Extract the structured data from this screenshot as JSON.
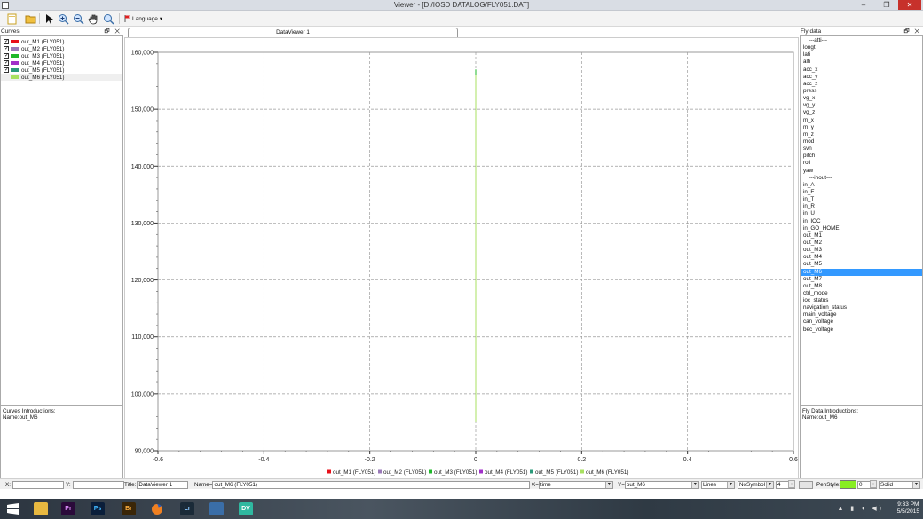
{
  "window": {
    "title": "Viewer - [D:/IOSD DATALOG/FLY051.DAT]"
  },
  "toolbar": {
    "language_label": "Language",
    "language_arrow": "▾"
  },
  "curves_panel": {
    "title": "Curves",
    "items": [
      {
        "label": "out_M1 (FLY051)",
        "color": "#e8101a",
        "checked": true
      },
      {
        "label": "out_M2 (FLY051)",
        "color": "#9a7ab8",
        "checked": true
      },
      {
        "label": "out_M3 (FLY051)",
        "color": "#1fb82a",
        "checked": true
      },
      {
        "label": "out_M4 (FLY051)",
        "color": "#a030c8",
        "checked": true
      },
      {
        "label": "out_M5 (FLY051)",
        "color": "#2a9a7a",
        "checked": true
      },
      {
        "label": "out_M6 (FLY051)",
        "color": "#a8e060",
        "checked": false
      }
    ],
    "intro_title": "Curves Introductions:",
    "intro_name": "Name:out_M6"
  },
  "tab": {
    "label": "DataViewer 1"
  },
  "chart_data": {
    "type": "line",
    "title": "",
    "xlabel": "",
    "ylabel": "",
    "xlim": [
      -0.6,
      0.6
    ],
    "ylim": [
      90000,
      160000
    ],
    "x_ticks": [
      "-0.6",
      "-0.4",
      "-0.2",
      "0",
      "0.2",
      "0.4",
      "0.6"
    ],
    "y_ticks": [
      "90,000",
      "100,000",
      "110,000",
      "120,000",
      "130,000",
      "140,000",
      "150,000",
      "160,000"
    ],
    "grid": true,
    "legend_placement": "bottom",
    "series": [
      {
        "name": "out_M1 (FLY051)",
        "color": "#e8101a",
        "x": [
          0,
          0
        ],
        "y": [
          150000,
          150000
        ]
      },
      {
        "name": "out_M2 (FLY051)",
        "color": "#9a7ab8",
        "x": [
          0,
          0
        ],
        "y": [
          150000,
          150000
        ]
      },
      {
        "name": "out_M3 (FLY051)",
        "color": "#1fb82a",
        "x": [
          0,
          0
        ],
        "y": [
          150000,
          157000
        ]
      },
      {
        "name": "out_M4 (FLY051)",
        "color": "#a030c8",
        "x": [
          0,
          0
        ],
        "y": [
          150000,
          150000
        ]
      },
      {
        "name": "out_M5 (FLY051)",
        "color": "#2a9a7a",
        "x": [
          0,
          0
        ],
        "y": [
          150000,
          150000
        ]
      },
      {
        "name": "out_M6 (FLY051)",
        "color": "#a8e060",
        "x": [
          0,
          0
        ],
        "y": [
          95000,
          156000
        ]
      }
    ]
  },
  "fly_panel": {
    "title": "Fly data",
    "items": [
      "---atti---",
      "longti",
      "lati",
      "alti",
      "acc_x",
      "acc_y",
      "acc_z",
      "press",
      "vg_x",
      "vg_y",
      "vg_z",
      "m_x",
      "m_y",
      "m_z",
      "mod",
      "svn",
      "pitch",
      "roll",
      "yaw",
      "---inout---",
      "in_A",
      "in_E",
      "in_T",
      "in_R",
      "in_U",
      "in_IOC",
      "in_GO_HOME",
      "out_M1",
      "out_M2",
      "out_M3",
      "out_M4",
      "out_M5",
      "out_M6",
      "out_M7",
      "out_M8",
      "ctrl_mode",
      "ioc_status",
      "navigation_status",
      "main_voltage",
      "can_voltage",
      "bec_voltage"
    ],
    "selected": "out_M6",
    "intro_title": "Fly Data Introductions:",
    "intro_name": "Name:out_M6"
  },
  "statusbar": {
    "x_label": "X:",
    "x_value": "",
    "y_label": "Y:",
    "y_value": "",
    "title_label": "Title:",
    "title_value": "DataViewer 1",
    "name_label": "Name=",
    "name_value": "out_M6 (FLY051)",
    "xsel_label": "X=",
    "xsel_value": "time",
    "ysel_label": "Y=",
    "ysel_value": "out_M6",
    "line_style": "Lines",
    "symbol": "NoSymbol",
    "size_value": "4",
    "penstyle_label": "PenStyle:",
    "pen_color": "#88ee22",
    "pen_width": "0",
    "pen_type": "Solid"
  },
  "taskbar": {
    "apps": [
      {
        "name": "windows-start",
        "label": "",
        "bg": "#2c3540"
      },
      {
        "name": "file-explorer",
        "label": "",
        "bg": "#e8b840"
      },
      {
        "name": "premiere",
        "label": "Pr",
        "bg": "#2a0a3a"
      },
      {
        "name": "photoshop",
        "label": "Ps",
        "bg": "#0a1e3a"
      },
      {
        "name": "bridge",
        "label": "Br",
        "bg": "#3a2608"
      },
      {
        "name": "firefox",
        "label": "",
        "bg": "#e05a20"
      },
      {
        "name": "lightroom",
        "label": "Lr",
        "bg": "#1a2a38"
      },
      {
        "name": "network-app",
        "label": "",
        "bg": "#3a6ea8"
      },
      {
        "name": "dv-app",
        "label": "DV",
        "bg": "#2fb8a0"
      }
    ],
    "time": "9:33 PM",
    "date": "5/5/2015"
  }
}
